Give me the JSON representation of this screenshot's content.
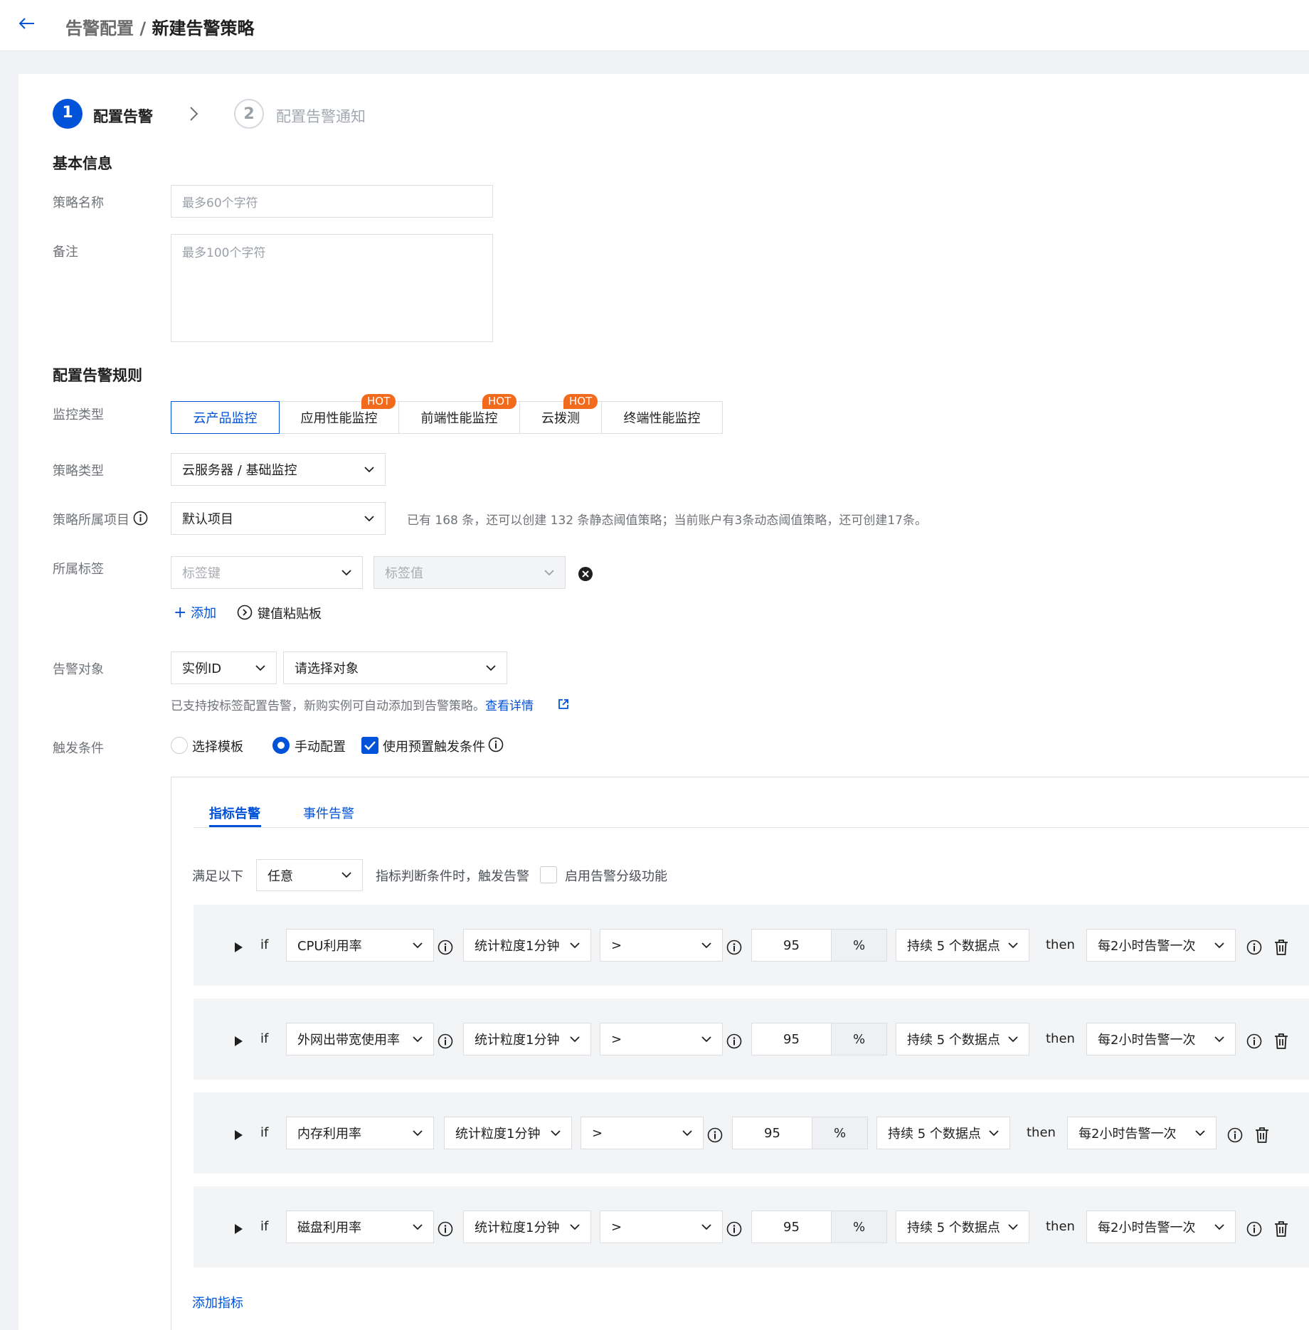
{
  "header": {
    "breadcrumb_parent": "告警配置 /",
    "breadcrumb_current": "新建告警策略"
  },
  "steps": [
    {
      "num": "1",
      "label": "配置告警"
    },
    {
      "num": "2",
      "label": "配置告警通知"
    }
  ],
  "basic": {
    "section_title": "基本信息",
    "name_label": "策略名称",
    "name_placeholder": "最多60个字符",
    "remark_label": "备注",
    "remark_placeholder": "最多100个字符"
  },
  "rules": {
    "section_title": "配置告警规则",
    "monitor_type_label": "监控类型",
    "monitor_tabs": [
      "云产品监控",
      "应用性能监控",
      "前端性能监控",
      "云拨测",
      "终端性能监控"
    ],
    "hot": "HOT",
    "policy_type_label": "策略类型",
    "policy_type_value": "云服务器 / 基础监控",
    "project_label": "策略所属项目",
    "project_value": "默认项目",
    "project_hint": "已有 168 条，还可以创建 132 条静态阈值策略；当前账户有3条动态阈值策略，还可创建17条。",
    "tag_label": "所属标签",
    "tag_key_placeholder": "标签键",
    "tag_value_placeholder": "标签值",
    "add_label": "添加",
    "paste_label": "键值粘贴板",
    "target_label": "告警对象",
    "target_type": "实例ID",
    "target_placeholder": "请选择对象",
    "target_hint": "已支持按标签配置告警，新购实例可自动添加到告警策略。",
    "target_link": "查看详情",
    "trigger_label": "触发条件",
    "opt_template": "选择模板",
    "opt_manual": "手动配置",
    "opt_preset": "使用预置触发条件"
  },
  "panel": {
    "tabs": [
      "指标告警",
      "事件告警"
    ],
    "cond_prefix": "满足以下",
    "cond_value": "任意",
    "cond_suffix": "指标判断条件时，触发告警",
    "grade_label": "启用告警分级功能",
    "if": "if",
    "then": "then",
    "rows": [
      {
        "metric": "CPU利用率",
        "period": "统计粒度1分钟",
        "op": ">",
        "value": "95",
        "unit": "%",
        "duration": "持续 5 个数据点",
        "freq": "每2小时告警一次"
      },
      {
        "metric": "外网出带宽使用率",
        "period": "统计粒度1分钟",
        "op": ">",
        "value": "95",
        "unit": "%",
        "duration": "持续 5 个数据点",
        "freq": "每2小时告警一次"
      },
      {
        "metric": "内存利用率",
        "period": "统计粒度1分钟",
        "op": ">",
        "value": "95",
        "unit": "%",
        "duration": "持续 5 个数据点",
        "freq": "每2小时告警一次"
      },
      {
        "metric": "磁盘利用率",
        "period": "统计粒度1分钟",
        "op": ">",
        "value": "95",
        "unit": "%",
        "duration": "持续 5 个数据点",
        "freq": "每2小时告警一次"
      }
    ],
    "add_metric": "添加指标"
  },
  "colors": {
    "primary": "#0052d9",
    "hot": "#f26a1b"
  }
}
